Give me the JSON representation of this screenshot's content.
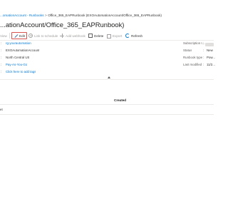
{
  "breadcrumb": {
    "items": [
      "...omationAccount - Runbooks",
      "Office_365_EAPRunbook (EXOAutomationAccount/Office_365_EAPRunbook)"
    ],
    "separator": ">"
  },
  "page_title": "...ationAccount/Office_365_EAPRunbook)",
  "toolbar": {
    "view_label": "View",
    "edit_label": "Edit",
    "link_label": "Link to schedule",
    "webhook_label": "Add webhook",
    "delete_label": "Delete",
    "export_label": "Export",
    "refresh_label": "Refresh"
  },
  "essentials": {
    "left": {
      "resource_group": "rg-yourautomation",
      "account": "EXOAutomationAccount",
      "location": "North Central US",
      "subscription": "Pay-As-You-Go",
      "tags": "Click here to add tags"
    },
    "right": {
      "labels": [
        "Subscription I...",
        "Status",
        "Runbook type",
        "Last modified"
      ],
      "values": [
        "",
        "New",
        "Pow...",
        "11/2..."
      ]
    }
  },
  "jobs_table": {
    "columns": [
      "Created"
    ],
    "row_fragment": "et"
  },
  "colors": {
    "accent": "#0078d4",
    "edit_highlight": "#d9534f",
    "text": "#323130",
    "disabled": "#a19f9d"
  }
}
